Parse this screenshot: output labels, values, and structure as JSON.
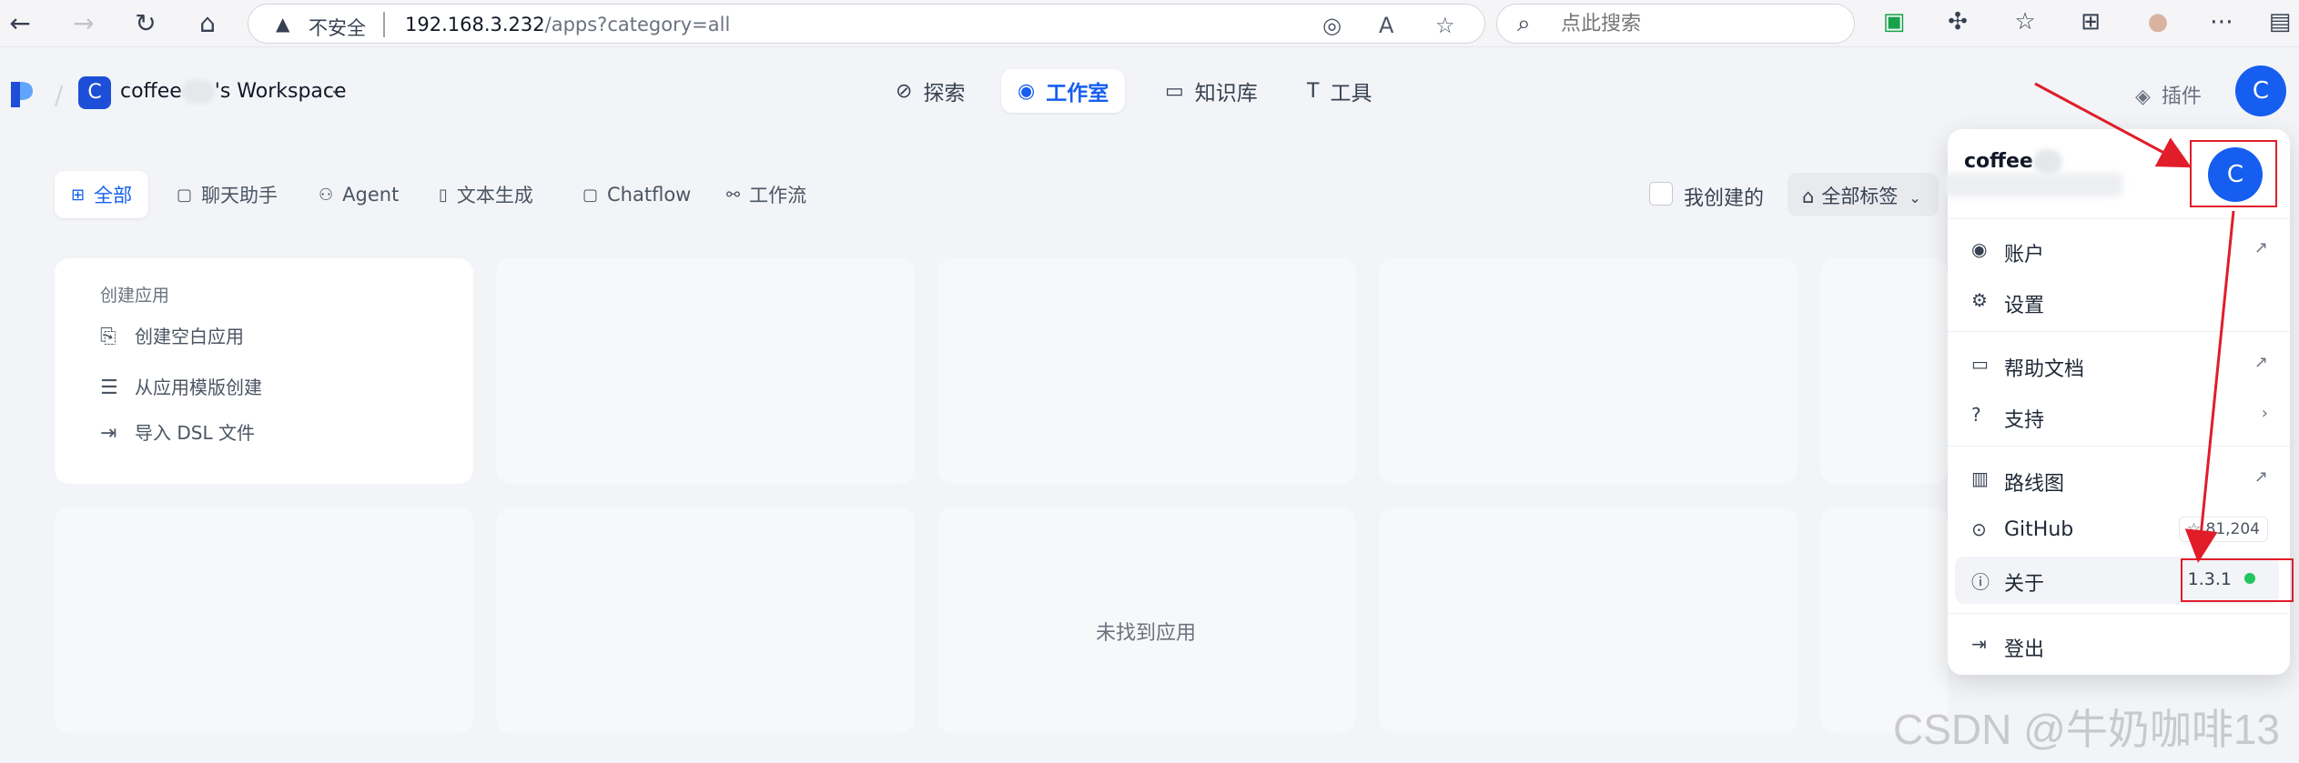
{
  "browser": {
    "insecure_label": "不安全",
    "url_host": "192.168.3.232",
    "url_path": "/apps?category=all",
    "search_placeholder": "点此搜索"
  },
  "header": {
    "workspace_initial": "C",
    "workspace_prefix": "coffee",
    "workspace_suffix": "'s Workspace",
    "nav": [
      {
        "label": "探索"
      },
      {
        "label": "工作室"
      },
      {
        "label": "知识库"
      },
      {
        "label": "工具"
      }
    ],
    "plugin_label": "插件",
    "user_initial": "C"
  },
  "categories": [
    {
      "label": "全部"
    },
    {
      "label": "聊天助手"
    },
    {
      "label": "Agent"
    },
    {
      "label": "文本生成"
    },
    {
      "label": "Chatflow"
    },
    {
      "label": "工作流"
    }
  ],
  "filters": {
    "mine_label": "我创建的",
    "tags_label": "全部标签"
  },
  "create_card": {
    "title": "创建应用",
    "items": [
      {
        "label": "创建空白应用"
      },
      {
        "label": "从应用模版创建"
      },
      {
        "label": "导入 DSL 文件"
      }
    ]
  },
  "empty_text": "未找到应用",
  "dropdown": {
    "user_name": "coffee",
    "avatar_initial": "C",
    "items": [
      {
        "label": "账户"
      },
      {
        "label": "设置"
      },
      {
        "label": "帮助文档"
      },
      {
        "label": "支持"
      },
      {
        "label": "路线图"
      },
      {
        "label": "GitHub",
        "stars": "81,204"
      },
      {
        "label": "关于",
        "version": "1.3.1"
      },
      {
        "label": "登出"
      }
    ]
  },
  "watermark": "CSDN @牛奶咖啡13",
  "colors": {
    "accent": "#155eef",
    "annotation": "#e11d2a",
    "status_ok": "#22c55e"
  }
}
